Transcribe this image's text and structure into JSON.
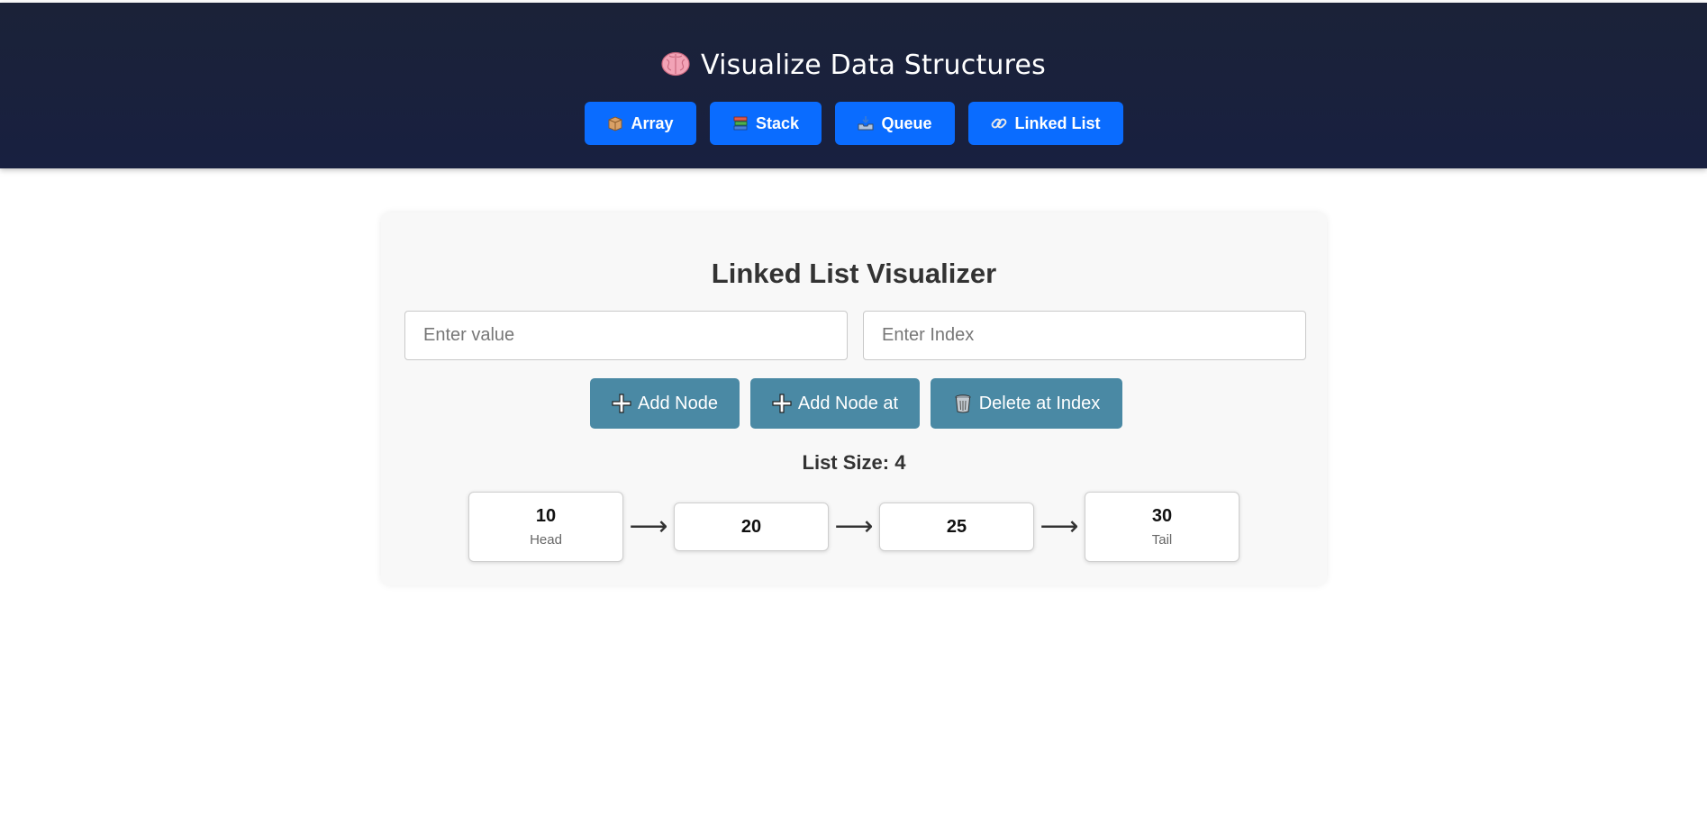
{
  "header": {
    "title": "Visualize Data Structures",
    "title_icon": "brain-icon",
    "nav": [
      {
        "label": "Array",
        "icon": "package-icon"
      },
      {
        "label": "Stack",
        "icon": "books-icon"
      },
      {
        "label": "Queue",
        "icon": "inbox-tray-icon"
      },
      {
        "label": "Linked List",
        "icon": "link-icon"
      }
    ]
  },
  "visualizer": {
    "title": "Linked List Visualizer",
    "value_input": {
      "placeholder": "Enter value",
      "value": ""
    },
    "index_input": {
      "placeholder": "Enter Index",
      "value": ""
    },
    "buttons": {
      "add_node": "Add Node",
      "add_node_at": "Add Node at",
      "delete_at_index": "Delete at Index"
    },
    "size_label": "List Size:",
    "size_value": "4",
    "arrow_glyph": "⟶",
    "nodes": [
      {
        "value": "10",
        "label": "Head"
      },
      {
        "value": "20",
        "label": ""
      },
      {
        "value": "25",
        "label": ""
      },
      {
        "value": "30",
        "label": "Tail"
      }
    ]
  },
  "colors": {
    "header_bg": "#1b2238",
    "nav_button": "#0a6cff",
    "action_button": "#4a89a4",
    "card_bg": "#f8f8f8"
  }
}
